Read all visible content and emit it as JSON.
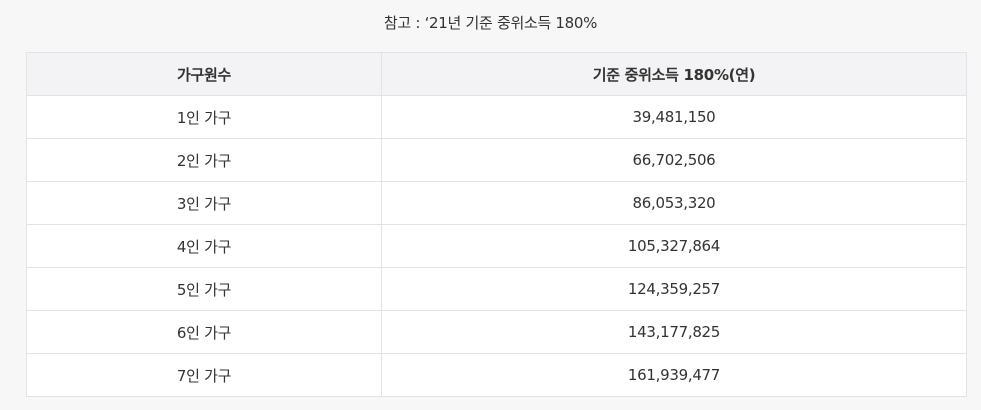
{
  "caption": "참고 : ‘21년 기준 중위소득 180%",
  "table": {
    "headers": [
      "가구원수",
      "기준 중위소득 180%(연)"
    ],
    "rows": [
      [
        "1인 가구",
        "39,481,150"
      ],
      [
        "2인 가구",
        "66,702,506"
      ],
      [
        "3인 가구",
        "86,053,320"
      ],
      [
        "4인 가구",
        "105,327,864"
      ],
      [
        "5인 가구",
        "124,359,257"
      ],
      [
        "6인 가구",
        "143,177,825"
      ],
      [
        "7인 가구",
        "161,939,477"
      ]
    ]
  }
}
